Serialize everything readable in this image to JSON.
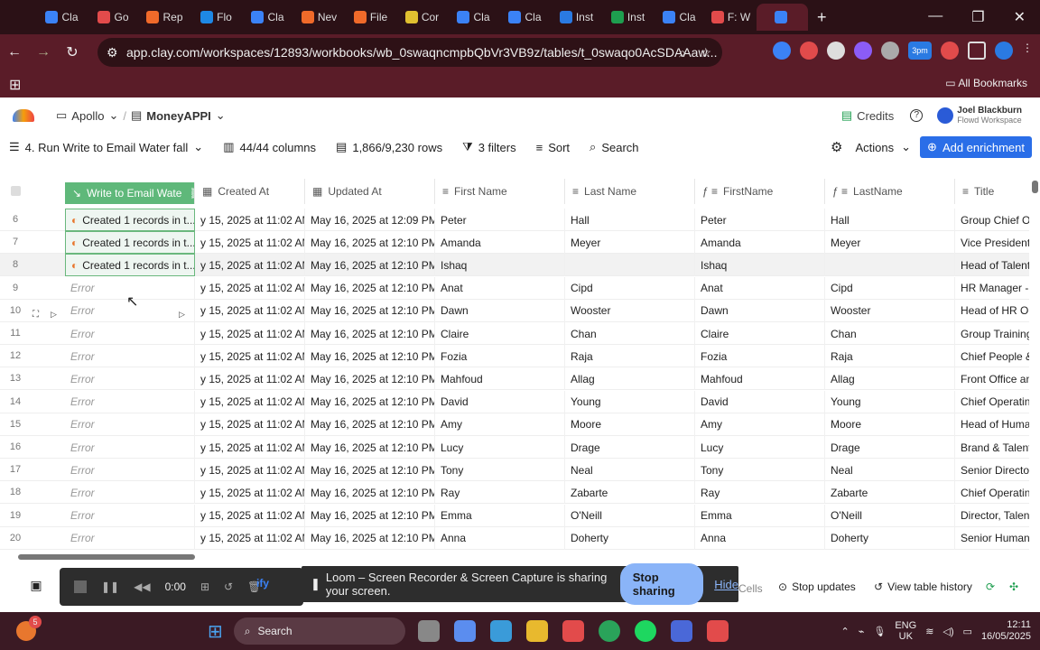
{
  "browser": {
    "tabs": [
      {
        "label": "Cla",
        "color": "#3b82f6"
      },
      {
        "label": "Go",
        "color": "#e24b4b"
      },
      {
        "label": "Rep",
        "color": "#f06a2a"
      },
      {
        "label": "Flo",
        "color": "#1e88e5"
      },
      {
        "label": "Cla",
        "color": "#3b82f6"
      },
      {
        "label": "Nev",
        "color": "#f06a2a"
      },
      {
        "label": "File",
        "color": "#f06a2a"
      },
      {
        "label": "Cor",
        "color": "#e0c030"
      },
      {
        "label": "Cla",
        "color": "#3b82f6"
      },
      {
        "label": "Cla",
        "color": "#3b82f6"
      },
      {
        "label": "Inst",
        "color": "#2a7ae2"
      },
      {
        "label": "Inst",
        "color": "#1e9e4f"
      },
      {
        "label": "Cla",
        "color": "#3b82f6"
      },
      {
        "label": "F: W",
        "color": "#e24b4b"
      },
      {
        "label": "",
        "color": "#3b82f6"
      }
    ],
    "url": "app.clay.com/workspaces/12893/workbooks/wb_0swaqncmpbQbVr3VB9z/tables/t_0swaqo0AcSDAAaw...",
    "bookmarks_label": "All Bookmarks",
    "ext_badge": "3pm"
  },
  "app": {
    "workspace": "Apollo",
    "workbook": "MoneyAPPI",
    "credits_label": "Credits",
    "user_name": "Joel Blackburn",
    "user_workspace": "Flowd Workspace"
  },
  "toolbar": {
    "view": "4. Run Write to Email Water fall",
    "columns": "44/44 columns",
    "rows": "1,866/9,230 rows",
    "filters": "3 filters",
    "sort": "Sort",
    "search": "Search",
    "actions": "Actions",
    "add_enrichment": "Add enrichment"
  },
  "columns": [
    "Write to Email Wate",
    "Created At",
    "Updated At",
    "First Name",
    "Last Name",
    "FirstName",
    "LastName",
    "Title"
  ],
  "rows": [
    {
      "n": "6",
      "c0": "Created 1 records in t...",
      "c1": "y 15, 2025 at 11:02 AM...",
      "c2": "May 16, 2025 at 12:09 PM...",
      "fn": "Peter",
      "ln": "Hall",
      "fn2": "Peter",
      "ln2": "Hall",
      "title": "Group Chief Op"
    },
    {
      "n": "7",
      "c0": "Created 1 records in t...",
      "c1": "y 15, 2025 at 11:02 AM...",
      "c2": "May 16, 2025 at 12:10 PM ...",
      "fn": "Amanda",
      "ln": "Meyer",
      "fn2": "Amanda",
      "ln2": "Meyer",
      "title": "Vice President,"
    },
    {
      "n": "8",
      "c0": "Created 1 records in t...",
      "c1": "y 15, 2025 at 11:02 AM...",
      "c2": "May 16, 2025 at 12:10 PM ...",
      "fn": "Ishaq",
      "ln": "",
      "fn2": "Ishaq",
      "ln2": "",
      "title": "Head of Talent A"
    },
    {
      "n": "9",
      "c0": "Error",
      "c1": "y 15, 2025 at 11:02 AM...",
      "c2": "May 16, 2025 at 12:10 PM ...",
      "fn": "Anat",
      "ln": "Cipd",
      "fn2": "Anat",
      "ln2": "Cipd",
      "title": "HR Manager - A"
    },
    {
      "n": "10",
      "c0": "Error",
      "c1": "y 15, 2025 at 11:02 AM...",
      "c2": "May 16, 2025 at 12:10 PM ...",
      "fn": "Dawn",
      "ln": "Wooster",
      "fn2": "Dawn",
      "ln2": "Wooster",
      "title": "Head of HR Ope"
    },
    {
      "n": "11",
      "c0": "Error",
      "c1": "y 15, 2025 at 11:02 AM...",
      "c2": "May 16, 2025 at 12:10 PM ...",
      "fn": "Claire",
      "ln": "Chan",
      "fn2": "Claire",
      "ln2": "Chan",
      "title": "Group Training"
    },
    {
      "n": "12",
      "c0": "Error",
      "c1": "y 15, 2025 at 11:02 AM...",
      "c2": "May 16, 2025 at 12:10 PM ...",
      "fn": "Fozia",
      "ln": "Raja",
      "fn2": "Fozia",
      "ln2": "Raja",
      "title": "Chief People &"
    },
    {
      "n": "13",
      "c0": "Error",
      "c1": "y 15, 2025 at 11:02 AM...",
      "c2": "May 16, 2025 at 12:10 PM ...",
      "fn": "Mahfoud",
      "ln": "Allag",
      "fn2": "Mahfoud",
      "ln2": "Allag",
      "title": "Front Office and"
    },
    {
      "n": "14",
      "c0": "Error",
      "c1": "y 15, 2025 at 11:02 AM...",
      "c2": "May 16, 2025 at 12:10 PM ...",
      "fn": "David",
      "ln": "Young",
      "fn2": "David",
      "ln2": "Young",
      "title": "Chief Operating"
    },
    {
      "n": "15",
      "c0": "Error",
      "c1": "y 15, 2025 at 11:02 AM...",
      "c2": "May 16, 2025 at 12:10 PM ...",
      "fn": "Amy",
      "ln": "Moore",
      "fn2": "Amy",
      "ln2": "Moore",
      "title": "Head of Human"
    },
    {
      "n": "16",
      "c0": "Error",
      "c1": "y 15, 2025 at 11:02 AM...",
      "c2": "May 16, 2025 at 12:10 PM ...",
      "fn": "Lucy",
      "ln": "Drage",
      "fn2": "Lucy",
      "ln2": "Drage",
      "title": "Brand & Talent I"
    },
    {
      "n": "17",
      "c0": "Error",
      "c1": "y 15, 2025 at 11:02 AM...",
      "c2": "May 16, 2025 at 12:10 PM ...",
      "fn": "Tony",
      "ln": "Neal",
      "fn2": "Tony",
      "ln2": "Neal",
      "title": "Senior Director,"
    },
    {
      "n": "18",
      "c0": "Error",
      "c1": "y 15, 2025 at 11:02 AM...",
      "c2": "May 16, 2025 at 12:10 PM ...",
      "fn": "Ray",
      "ln": "Zabarte",
      "fn2": "Ray",
      "ln2": "Zabarte",
      "title": "Chief Operating"
    },
    {
      "n": "19",
      "c0": "Error",
      "c1": "y 15, 2025 at 11:02 AM...",
      "c2": "May 16, 2025 at 12:10 PM ...",
      "fn": "Emma",
      "ln": "O'Neill",
      "fn2": "Emma",
      "ln2": "O'Neill",
      "title": "Director, Talent"
    },
    {
      "n": "20",
      "c0": "Error",
      "c1": "y 15, 2025 at 11:02 AM...",
      "c2": "May 16, 2025 at 12:10 PM ...",
      "fn": "Anna",
      "ln": "Doherty",
      "fn2": "Anna",
      "ln2": "Doherty",
      "title": "Senior Human R"
    }
  ],
  "bottom": {
    "timer": "0:00",
    "cells": "Cells",
    "stop_updates": "Stop updates",
    "view_history": "View table history",
    "partial": "ify"
  },
  "loom": {
    "message": "Loom – Screen Recorder & Screen Capture is sharing your screen.",
    "stop": "Stop sharing",
    "hide": "Hide"
  },
  "taskbar": {
    "search": "Search",
    "lang1": "ENG",
    "lang2": "UK",
    "time": "12:11",
    "date": "16/05/2025",
    "badge": "5"
  }
}
